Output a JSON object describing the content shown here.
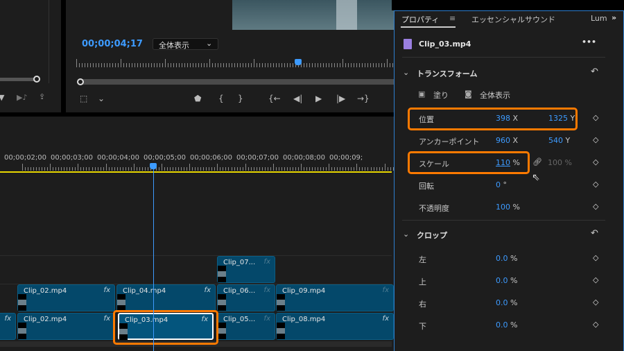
{
  "program_monitor": {
    "timecode": "00;00;04;17",
    "zoom_select": "全体表示"
  },
  "timeline": {
    "ruler_labels": [
      "00;00;02;00",
      "00;00;03;00",
      "00;00;04;00",
      "00;00;05;00",
      "00;00;06;00",
      "00;00;07;00",
      "00;00;08;00",
      "00;00;09;"
    ],
    "tracks": {
      "v3": [
        {
          "name": "Clip_07...",
          "fx": true
        }
      ],
      "v2": [
        {
          "name": "Clip_02.mp4",
          "fx": true
        },
        {
          "name": "Clip_04.mp4",
          "fx": true
        },
        {
          "name": "Clip_06...",
          "fx": true
        },
        {
          "name": "Clip_09.mp4",
          "fx": false
        }
      ],
      "v1": [
        {
          "name": "",
          "fx": true
        },
        {
          "name": "Clip_02.mp4",
          "fx": true
        },
        {
          "name": "Clip_03.mp4",
          "fx": true,
          "selected": true
        },
        {
          "name": "Clip_05...",
          "fx": true
        },
        {
          "name": "Clip_08.mp4",
          "fx": false
        }
      ]
    }
  },
  "properties": {
    "tabs": [
      {
        "label": "プロパティ",
        "active": true
      },
      {
        "label": "エッセンシャルサウンド"
      },
      {
        "label": "Lum"
      }
    ],
    "clip_name": "Clip_03.mp4",
    "transform": {
      "title": "トランスフォーム",
      "fill_label": "塗り",
      "fit_label": "全体表示",
      "position": {
        "label": "位置",
        "x": "398",
        "y": "1325",
        "x_unit": "X",
        "y_unit": "Y"
      },
      "anchor": {
        "label": "アンカーポイント",
        "x": "960",
        "y": "540",
        "x_unit": "X",
        "y_unit": "Y"
      },
      "scale": {
        "label": "スケール",
        "value": "110",
        "unit": "%",
        "linked_value": "100 %"
      },
      "rotation": {
        "label": "回転",
        "value": "0",
        "unit": "°"
      },
      "opacity": {
        "label": "不透明度",
        "value": "100",
        "unit": "%"
      }
    },
    "crop": {
      "title": "クロップ",
      "rows": [
        {
          "label": "左",
          "value": "0.0",
          "unit": "%"
        },
        {
          "label": "上",
          "value": "0.0",
          "unit": "%"
        },
        {
          "label": "右",
          "value": "0.0",
          "unit": "%"
        },
        {
          "label": "下",
          "value": "0.0",
          "unit": "%"
        }
      ]
    }
  },
  "colors": {
    "accent": "#3d9bff",
    "highlight": "#ff7a00",
    "clip": "#04486a",
    "work_area": "#e8d800"
  }
}
